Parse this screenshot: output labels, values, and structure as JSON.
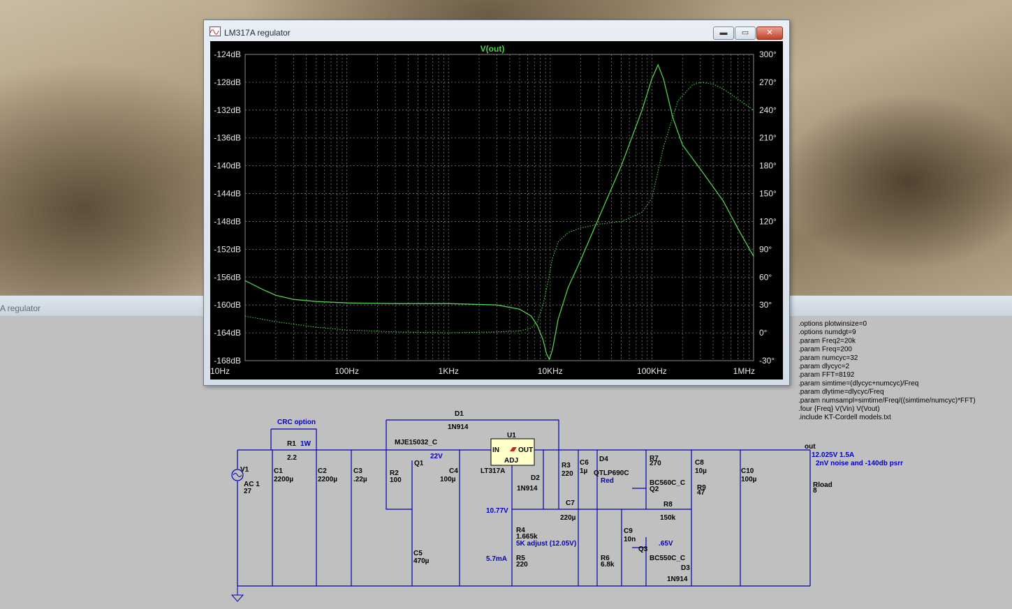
{
  "desktop": {
    "background_tone": "#b5a68a"
  },
  "plot_window": {
    "title": "LM317A regulator",
    "icon": "waveform-icon",
    "buttons": {
      "minimize": "▬",
      "maximize": "▭",
      "close": "✕"
    }
  },
  "schematic_window": {
    "title": "A regulator"
  },
  "chart_data": {
    "type": "line",
    "title": "V(out)",
    "x_scale": "log",
    "x_ticks": [
      "10Hz",
      "100Hz",
      "1KHz",
      "10KHz",
      "100KHz",
      "1MHz"
    ],
    "xlim_hz": [
      10,
      1000000
    ],
    "y_left_ticks": [
      "-124dB",
      "-128dB",
      "-132dB",
      "-136dB",
      "-140dB",
      "-144dB",
      "-148dB",
      "-152dB",
      "-156dB",
      "-160dB",
      "-164dB",
      "-168dB"
    ],
    "ylim_left_db": [
      -168,
      -124
    ],
    "y_right_ticks": [
      "300°",
      "270°",
      "240°",
      "210°",
      "180°",
      "150°",
      "120°",
      "90°",
      "60°",
      "30°",
      "0°",
      "-30°"
    ],
    "ylim_right_deg": [
      -30,
      300
    ],
    "grid": true,
    "background": "#000000",
    "trace_color": "#4fd04f",
    "series": [
      {
        "style": "solid",
        "x": [
          10,
          15,
          20,
          30,
          50,
          100,
          300,
          1000,
          3000,
          5000,
          6500,
          7500,
          8500,
          9200,
          9800,
          10500,
          12000,
          15000,
          20000,
          30000,
          50000,
          80000,
          100000,
          115000,
          130000,
          160000,
          200000,
          300000,
          500000,
          700000,
          1000000
        ],
        "y": [
          -156.5,
          -157.8,
          -158.6,
          -159.2,
          -159.5,
          -159.7,
          -159.8,
          -159.8,
          -160.0,
          -160.6,
          -161.6,
          -163.0,
          -165.0,
          -167.0,
          -167.8,
          -166.5,
          -162.0,
          -157.5,
          -153.5,
          -147.5,
          -140.0,
          -132.0,
          -127.5,
          -125.5,
          -127.5,
          -133.0,
          -137.0,
          -140.5,
          -145.0,
          -149.0,
          -153.0
        ]
      },
      {
        "style": "dotted",
        "x": [
          10,
          20,
          50,
          100,
          300,
          1000,
          3000,
          5000,
          6500,
          7500,
          8500,
          9500,
          10500,
          12000,
          15000,
          20000,
          30000,
          50000,
          80000,
          100000,
          130000,
          180000,
          250000,
          300000,
          400000,
          500000,
          700000,
          1000000
        ],
        "y_deg": [
          18,
          12,
          6,
          3,
          1,
          0,
          1,
          2,
          5,
          12,
          30,
          55,
          80,
          98,
          108,
          113,
          117,
          120,
          130,
          145,
          200,
          250,
          267,
          270,
          268,
          263,
          252,
          240
        ]
      }
    ]
  },
  "schematic": {
    "directives": [
      ".options plotwinsize=0",
      ".options numdgt=9",
      " .param Freq2=20k",
      ".param Freq=200",
      ".param numcyc=32",
      ".param dlycyc=2",
      ".param FFT=8192",
      ".param simtime=(dlycyc+numcyc)/Freq",
      ".param dlytime=dlycyc/Freq",
      ".param numsampl=simtime/Freq/((simtime/numcyc)*FFT)",
      ".four {Freq} V(Vin) V(Vout)",
      ".include KT-Cordell models.txt"
    ],
    "blue_notes": {
      "crc": "CRC option",
      "r1_watt": "1W",
      "v22": "22V",
      "v1077": "10.77V",
      "adj": "5K adjust (12.05V)",
      "ma": "5.7mA",
      "red": "Red",
      "v065": ".65V",
      "spec": "12.025V 1.5A",
      "noise": "2nV noise and  -140db psrr"
    },
    "labels": {
      "out": "out",
      "V1": "V1",
      "V1v": "AC 1",
      "V1n": "27",
      "R1": "R1",
      "R1v": "2.2",
      "C1": "C1",
      "C1v": "2200µ",
      "C2": "C2",
      "C2v": "2200µ",
      "C3": "C3",
      "C3v": ".22µ",
      "R2": "R2",
      "R2v": "100",
      "Q1": "Q1",
      "Q1m": "MJE15032_C",
      "C5": "C5",
      "C5v": "470µ",
      "C4": "C4",
      "C4v": "100µ",
      "D1": "D1",
      "D1m": "1N914",
      "U1": "U1",
      "U1m": "LT317A",
      "IN": "IN",
      "OUT": "OUT",
      "ADJ": "ADJ",
      "D2": "D2",
      "D2m": "1N914",
      "R3": "R3",
      "R3v": "220",
      "C6": "C6",
      "C6v": "1µ",
      "D4": "D4",
      "D4m": "QTLP690C",
      "R7": "R7",
      "R7v": "270",
      "Q2": "Q2",
      "Q2m": "BC560C_C",
      "C8": "C8",
      "C8v": "10µ",
      "R9": "R9",
      "R9v": "47",
      "C10": "C10",
      "C10v": "100µ",
      "Rload": "Rload",
      "Rloadv": "8",
      "C7": "C7",
      "C7v": "220µ",
      "R8": "R8",
      "R8v": "150k",
      "R4": "R4",
      "R4v": "1.665k",
      "R5": "R5",
      "R5v": "220",
      "C9": "C9",
      "C9v": "10n",
      "R6": "R6",
      "R6v": "6.8k",
      "Q3": "Q3",
      "Q3m": "BC550C_C",
      "D3": "D3",
      "D3m": "1N914"
    }
  }
}
